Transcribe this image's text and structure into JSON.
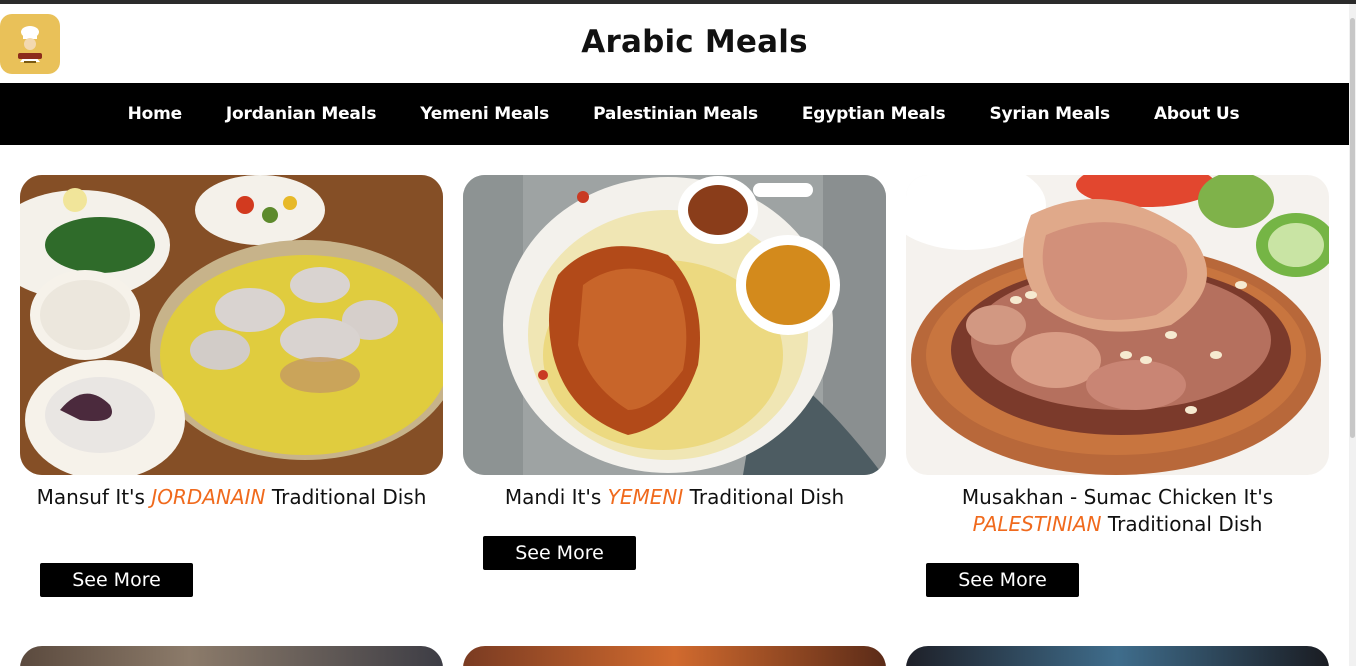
{
  "site": {
    "title": "Arabic Meals",
    "logo_icon": "chef-logo-icon"
  },
  "nav": {
    "items": [
      {
        "label": "Home"
      },
      {
        "label": "Jordanian Meals"
      },
      {
        "label": "Yemeni Meals"
      },
      {
        "label": "Palestinian Meals"
      },
      {
        "label": "Egyptian Meals"
      },
      {
        "label": "Syrian Meals"
      },
      {
        "label": "About Us"
      }
    ]
  },
  "cards": [
    {
      "dish": "Mansuf",
      "its": "It's",
      "country": "JORDANAIN",
      "suffix": "Traditional Dish",
      "button": "See More"
    },
    {
      "dish": "Mandi",
      "its": "It's",
      "country": "YEMENI",
      "suffix": "Traditional Dish",
      "button": "See More"
    },
    {
      "dish": "Musakhan - Sumac Chicken",
      "its": "It's",
      "country": "PALESTINIAN",
      "suffix": "Traditional Dish",
      "button": "See More"
    }
  ],
  "colors": {
    "accent": "#f06a1d",
    "navbar": "#000000",
    "button": "#000000",
    "logo_bg": "#e9c159"
  }
}
